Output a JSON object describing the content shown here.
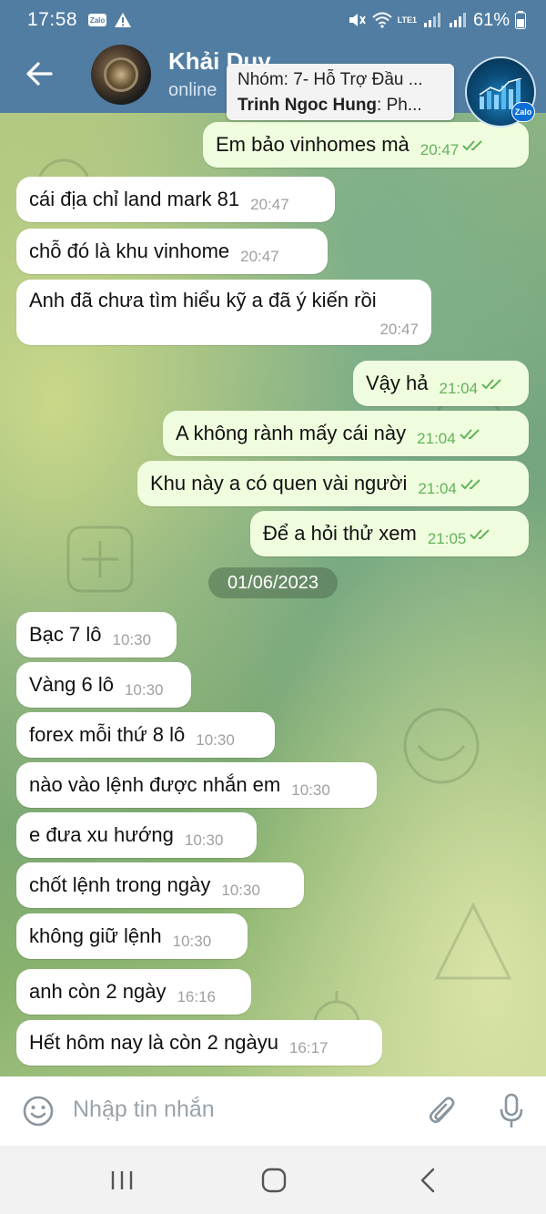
{
  "status_bar": {
    "time": "17:58",
    "battery": "61%",
    "zalo_badge": "Zalo",
    "network_label": "LTE1"
  },
  "header": {
    "contact_name": "Khải Duy",
    "contact_status": "online"
  },
  "notification": {
    "group_line": "Nhóm: 7- Hỗ Trợ Đầu ...",
    "sender": "Trinh Ngoc Hung",
    "preview": ": Ph...",
    "app_badge": "Zalo"
  },
  "messages": [
    {
      "text": "Em bảo vinhomes mà",
      "time": "20:47",
      "dir": "out"
    },
    {
      "text": "cái địa chỉ land mark 81",
      "time": "20:47",
      "dir": "in"
    },
    {
      "text": "chỗ đó là khu vinhome",
      "time": "20:47",
      "dir": "in"
    },
    {
      "text": "Anh đã chưa tìm hiểu kỹ a đã ý kiến rồi",
      "time": "20:47",
      "dir": "in"
    },
    {
      "text": "Vậy hả",
      "time": "21:04",
      "dir": "out"
    },
    {
      "text": "A không rành mấy cái này",
      "time": "21:04",
      "dir": "out"
    },
    {
      "text": "Khu này a có quen vài người",
      "time": "21:04",
      "dir": "out"
    },
    {
      "text": "Để a hỏi thử xem",
      "time": "21:05",
      "dir": "out"
    },
    {
      "text": "Bạc 7 lô",
      "time": "10:30",
      "dir": "in"
    },
    {
      "text": "Vàng 6 lô",
      "time": "10:30",
      "dir": "in"
    },
    {
      "text": "forex mỗi thứ 8 lô",
      "time": "10:30",
      "dir": "in"
    },
    {
      "text": "nào vào lệnh được nhắn em",
      "time": "10:30",
      "dir": "in"
    },
    {
      "text": "e đưa xu hướng",
      "time": "10:30",
      "dir": "in"
    },
    {
      "text": "chốt lệnh trong ngày",
      "time": "10:30",
      "dir": "in"
    },
    {
      "text": "không giữ lệnh",
      "time": "10:30",
      "dir": "in"
    },
    {
      "text": "anh còn 2 ngày",
      "time": "16:16",
      "dir": "in"
    },
    {
      "text": "Hết hôm nay là còn  2 ngàyu",
      "time": "16:17",
      "dir": "in"
    }
  ],
  "date_divider": "01/06/2023",
  "input": {
    "placeholder": "Nhập tin nhắn"
  },
  "colors": {
    "header_bg": "#517da2",
    "bubble_out": "#effdde",
    "bubble_in": "#ffffff",
    "tick_green": "#64b25a"
  },
  "icons": [
    "back-arrow-icon",
    "call-icon",
    "smile-icon",
    "paperclip-icon",
    "mic-icon",
    "recent-apps-icon",
    "home-icon",
    "nav-back-icon"
  ]
}
